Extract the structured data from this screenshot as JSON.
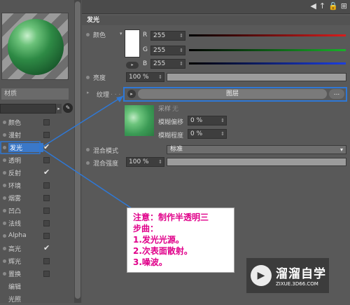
{
  "left_panel": {
    "material_label": "材质",
    "channels": [
      {
        "label": "颜色",
        "checked": false
      },
      {
        "label": "漫射",
        "checked": false
      },
      {
        "label": "发光",
        "checked": true,
        "selected": true
      },
      {
        "label": "透明",
        "checked": false
      },
      {
        "label": "反射",
        "checked": true
      },
      {
        "label": "环境",
        "checked": false
      },
      {
        "label": "烟雾",
        "checked": false
      },
      {
        "label": "凹凸",
        "checked": false
      },
      {
        "label": "法线",
        "checked": false
      },
      {
        "label": "Alpha",
        "checked": false
      },
      {
        "label": "高光",
        "checked": true
      },
      {
        "label": "辉光",
        "checked": false
      },
      {
        "label": "置换",
        "checked": false
      },
      {
        "label": "编辑",
        "checked": null
      },
      {
        "label": "光照",
        "checked": null
      }
    ],
    "checkmark": "✔"
  },
  "section": {
    "title": "发光"
  },
  "color": {
    "label": "颜色",
    "swatch": "#ffffff",
    "r_label": "R",
    "r_value": "255",
    "g_label": "G",
    "g_value": "255",
    "b_label": "B",
    "b_value": "255"
  },
  "brightness": {
    "label": "亮度",
    "value": "100 %",
    "level": 1.0
  },
  "texture": {
    "label": "纹理",
    "button_label": "图层",
    "more_label": "...",
    "sampling_label": "采样",
    "sampling_value": "无",
    "blur_offset_label": "模糊偏移",
    "blur_offset_value": "0 %",
    "blur_scale_label": "模糊程度",
    "blur_scale_value": "0 %"
  },
  "blend": {
    "mode_label": "混合模式",
    "mode_value": "标准",
    "strength_label": "混合强度",
    "strength_value": "100 %",
    "strength_level": 1.0
  },
  "note": {
    "line1": "注意：制作半透明三",
    "line2": "步曲：",
    "line3": "1.发光光源。",
    "line4": "2.次表面散射。",
    "line5": "3.噪波。"
  },
  "watermark": {
    "title": "溜溜自学",
    "subtitle": "ZIXUE.3D66.COM"
  },
  "colors": {
    "highlight": "#2f78d5",
    "note_text": "#e0008a",
    "red_bar": "#d81c1c",
    "green_bar": "#19b12a",
    "blue_bar": "#1c3ee0"
  },
  "icons": [
    "arrow-left-icon",
    "up-arrow-icon",
    "lock-icon",
    "pin-icon",
    "eyedropper-icon",
    "spinner-icon"
  ]
}
